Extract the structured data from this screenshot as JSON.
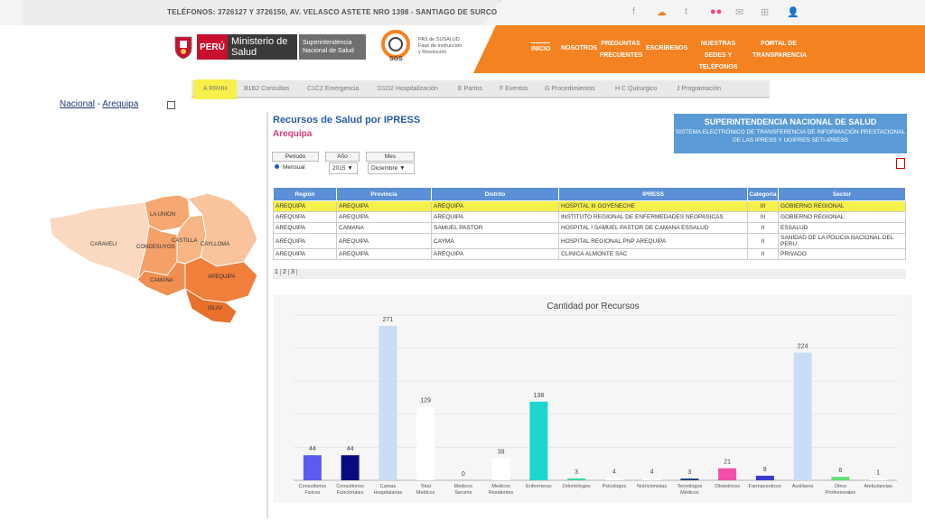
{
  "topbar": {
    "phone_text": "TELÉFONOS: 3726127 Y 3726150, AV. VELASCO ASTETE NRO 1398 - SANTIAGO DE SURCO",
    "social_icons": [
      "facebook-icon",
      "soundcloud-icon",
      "twitter-icon",
      "flickr-icon",
      "mail-icon",
      "sitemap-icon",
      "user-icon"
    ],
    "social_glyphs": [
      "f",
      "☁",
      "t",
      "●●",
      "✉",
      "⊞",
      "👤"
    ]
  },
  "header": {
    "peru_label": "PERÚ",
    "ministerio_label": "Ministerio de Salud",
    "supsa_label": "Superintendencia Nacional de Salud",
    "sgs_text": "PAS de SUSALUD Fase de Instrucción y Resolución",
    "sgs_mark": "SGS",
    "nav": [
      "INICIO",
      "NOSOTROS",
      "PREGUNTAS FRECUENTES",
      "ESCRÍBENOS",
      "NUESTRAS SEDES Y TELÉFONOS",
      "PORTAL DE TRANSPARENCIA"
    ],
    "brand_color": "#f58220"
  },
  "tabs": [
    "A RRHH",
    "B1B2 Consultas",
    "C1C2 Emergencia",
    "D1D2 Hospitalización",
    "E Partos",
    "F Eventos",
    "G Procedimientos",
    "H C Quirurgico",
    "J Programación"
  ],
  "breadcrumb": {
    "nacional": "Nacional",
    "sep": " - ",
    "region": "Arequipa"
  },
  "report": {
    "title": "Recursos de Salud por IPRESS",
    "subtitle": "Arequipa"
  },
  "sns_box": {
    "title": "SUPERINTENDENCIA NACIONAL DE SALUD",
    "sub": "SISTEMA ELECTRÓNICO DE TRANSFERENCIA DE INFORMACIÓN PRESTACIONAL DE LAS IPRESS Y UGIPRES SETI-IPRESS"
  },
  "filters": {
    "periodo_label": "Periodo",
    "periodo_value": "Mensual",
    "anio_label": "Año",
    "anio_value": "2015",
    "mes_label": "Mes",
    "mes_value": "Diciembre"
  },
  "table": {
    "headers": [
      "Región",
      "Provincia",
      "Distrito",
      "IPRESS",
      "Categoría",
      "Sector"
    ],
    "rows": [
      [
        "AREQUIPA",
        "AREQUIPA",
        "AREQUIPA",
        "HOSPITAL III GOYENECHE",
        "III",
        "GOBIERNO REGIONAL"
      ],
      [
        "AREQUIPA",
        "AREQUIPA",
        "AREQUIPA",
        "INSTITUTO REGIONAL DE ENFERMEDADES NEOPASICAS",
        "III",
        "GOBIERNO REGIONAL"
      ],
      [
        "AREQUIPA",
        "CAMANA",
        "SAMUEL PASTOR",
        "HOSPITAL I SAMUEL PASTOR DE CAMANA ESSALUD",
        "II",
        "ESSALUD"
      ],
      [
        "AREQUIPA",
        "AREQUIPA",
        "CAYMA",
        "HOSPITAL REGIONAL PNP AREQUIPA",
        "II",
        "SANIDAD DE LA POLICIA NACIONAL DEL PERU"
      ],
      [
        "AREQUIPA",
        "AREQUIPA",
        "AREQUIPA",
        "CLINICA ALMONTE SAC",
        "II",
        "PRIVADO"
      ]
    ],
    "pages": [
      "1",
      "2",
      "3"
    ]
  },
  "map": {
    "regions": [
      "LA UNION",
      "CARAVELI",
      "CONDESUYOS",
      "CASTILLA",
      "CAYLLOMA",
      "CAMANA",
      "AREQUIPA",
      "ISLAY"
    ]
  },
  "chart_data": {
    "type": "bar",
    "title": "Cantidad por Recursos",
    "categories": [
      "Consultorios Fisicos",
      "Consultorios Funcionales",
      "Camas Hospitalarias",
      "Total Medicos",
      "Medicos Serums",
      "Medicos Residentes",
      "Enfermeras",
      "Odontólogos",
      "Psicologos",
      "Nutricionistas",
      "Tecnólogos Médicos",
      "Obstetrices",
      "Farmaceuticos",
      "Auxiliares",
      "Otros Profesionales",
      "Ambulancias"
    ],
    "values": [
      44,
      44,
      271,
      129,
      0,
      39,
      138,
      3,
      4,
      4,
      3,
      21,
      8,
      224,
      6,
      1
    ],
    "colors": [
      "#5b5bf0",
      "#0a0a80",
      "#c9def5",
      "#ffffff",
      "#ffffff",
      "#ffffff",
      "#1fd6cf",
      "#38d3a0",
      "#ffffff",
      "#ffffff",
      "#1a3b7a",
      "#f050a8",
      "#3a3ad0",
      "#c9def5",
      "#60e070",
      "#ffffff"
    ],
    "ylim": [
      0,
      290
    ],
    "grid": true
  }
}
